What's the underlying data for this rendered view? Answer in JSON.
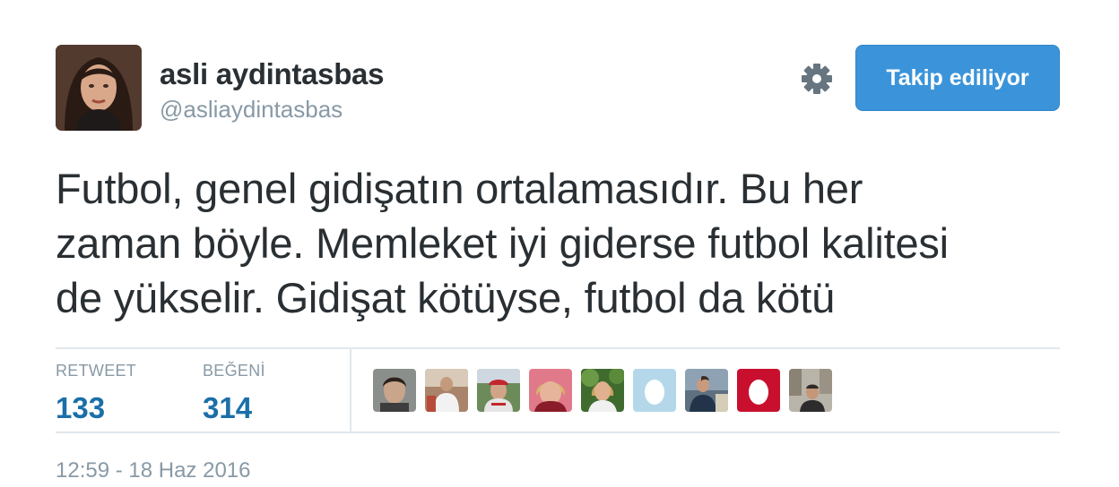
{
  "user": {
    "display_name": "asli aydintasbas",
    "handle": "@asliaydintasbas",
    "avatar": "profile-photo"
  },
  "actions": {
    "settings_icon": "gear-icon",
    "follow_button_label": "Takip ediliyor"
  },
  "tweet": {
    "lines": [
      "Futbol, genel gidişatın ortalamasıdır. Bu her",
      "zaman böyle. Memleket iyi giderse futbol kalitesi",
      "de yükselir. Gidişat kötüyse, futbol da kötü"
    ]
  },
  "stats": {
    "retweets": {
      "label": "RETWEET",
      "count": "133"
    },
    "likes": {
      "label": "BEĞENİ",
      "count": "314"
    }
  },
  "likers": [
    {
      "name": "liker-1",
      "kind": "photo"
    },
    {
      "name": "liker-2",
      "kind": "photo"
    },
    {
      "name": "liker-3",
      "kind": "photo"
    },
    {
      "name": "liker-4",
      "kind": "photo"
    },
    {
      "name": "liker-5",
      "kind": "photo"
    },
    {
      "name": "liker-6",
      "kind": "default-egg"
    },
    {
      "name": "liker-7",
      "kind": "photo"
    },
    {
      "name": "liker-8",
      "kind": "default-egg"
    },
    {
      "name": "liker-9",
      "kind": "photo"
    }
  ],
  "timestamp": "12:59 - 18 Haz 2016",
  "colors": {
    "follow_button": "#3b94d9",
    "count_blue": "#1b6fa8",
    "muted_gray": "#8899a6",
    "text": "#292f33",
    "divider": "#e1e8ed"
  }
}
